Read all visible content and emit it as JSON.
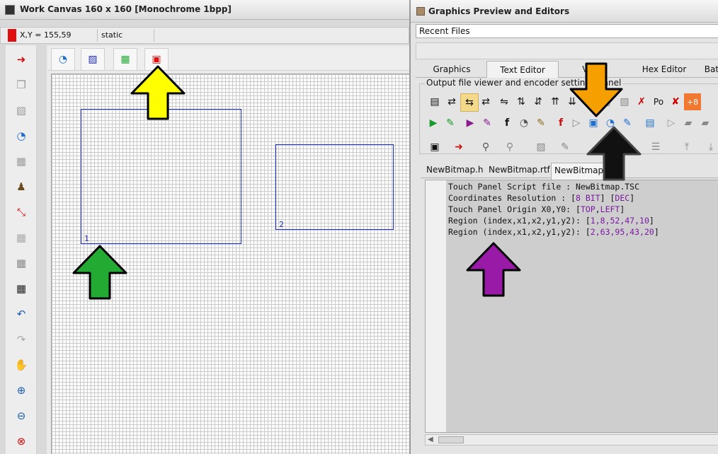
{
  "work_canvas": {
    "title": "Work Canvas 160 x 160 [Monochrome 1bpp]",
    "status": {
      "coords": "X,Y = 155,59",
      "mode": "static"
    },
    "side_tools": [
      "import-icon",
      "copy-icon",
      "paste-icon",
      "cursor-icon",
      "film-icon",
      "stamp-icon",
      "resize-icon",
      "grid-light-icon",
      "grid-medium-icon",
      "grid-icon",
      "undo-icon",
      "redo-icon",
      "hand-icon",
      "zoom-in-icon",
      "zoom-out-icon",
      "zoom-reset-icon"
    ],
    "canvas_tools": [
      "cursor-tool-icon",
      "rect-tool-icon",
      "grid-tool-icon",
      "region-tool-icon"
    ],
    "regions": [
      {
        "label": "1"
      },
      {
        "label": "2"
      }
    ]
  },
  "preview": {
    "title": "Graphics Preview and Editors",
    "recent_files": "Recent Files",
    "tabs": [
      "Graphics",
      "Text Editor",
      "Video",
      "Hex Editor",
      "Batch"
    ],
    "settings_label": "Output file viewer and encoder settings panel",
    "icon_text": {
      "po": "Po",
      "eight": "+8"
    },
    "file_tabs": [
      "NewBitmap.h",
      "NewBitmap.rtf",
      "NewBitmap.TSC"
    ],
    "code": {
      "l1": "Touch Panel Script file : NewBitmap.TSC",
      "l2a": "Coordinates Resolution : [",
      "l2b": "8 BIT",
      "l2c": "] [",
      "l2d": "DEC",
      "l2e": "]",
      "l3a": "Touch Panel Origin X0,Y0: [",
      "l3b": "TOP",
      "l3c": ",",
      "l3d": "LEFT",
      "l3e": "]",
      "l4a": "Region (index,x1,x2,y1,y2): [",
      "l4b": "1,8,52,47,10",
      "l4c": "]",
      "l5a": "Region (index,x1,x2,y1,y2): [",
      "l5b": "2,63,95,43,20",
      "l5c": "]"
    }
  },
  "colors": {
    "yellow": "#ffff00",
    "green": "#22aa33",
    "orange": "#f5a000",
    "black": "#111111",
    "purple": "#9a1aa8"
  }
}
